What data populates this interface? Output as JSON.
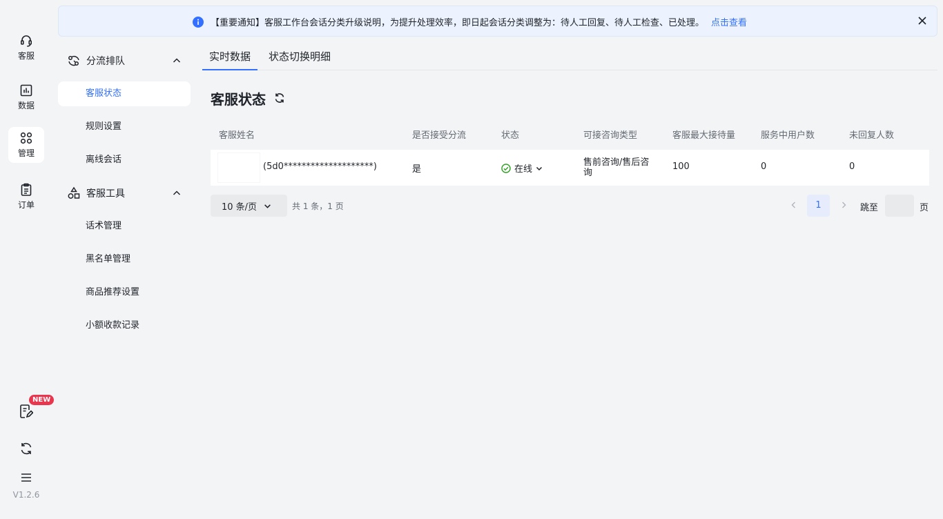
{
  "rail": {
    "items": [
      {
        "label": "客服",
        "icon": "headset-icon"
      },
      {
        "label": "数据",
        "icon": "bar-chart-icon"
      },
      {
        "label": "管理",
        "icon": "apps-icon"
      },
      {
        "label": "订单",
        "icon": "clipboard-icon"
      }
    ],
    "new_badge": "NEW",
    "version": "V1.2.6"
  },
  "notice": {
    "text": "【重要通知】客服工作台会话分类升级说明，为提升处理效率，即日起会话分类调整为：待人工回复、待人工检查、已处理。",
    "link": "点击查看"
  },
  "menu": {
    "group1": {
      "label": "分流排队",
      "items": [
        "客服状态",
        "规则设置",
        "离线会话"
      ]
    },
    "group2": {
      "label": "客服工具",
      "items": [
        "话术管理",
        "黑名单管理",
        "商品推荐设置",
        "小额收款记录"
      ]
    }
  },
  "tabs": [
    "实时数据",
    "状态切换明细"
  ],
  "page_title": "客服状态",
  "table": {
    "headers": [
      "客服姓名",
      "是否接受分流",
      "状态",
      "可接咨询类型",
      "客服最大接待量",
      "服务中用户数",
      "未回复人数"
    ],
    "rows": [
      {
        "name": "(5d0********************)",
        "accept": "是",
        "status": "在线",
        "types_line1": "售前咨询/售后咨",
        "types_line2": "询",
        "max": "100",
        "serving": "0",
        "unreplied": "0"
      }
    ]
  },
  "pagination": {
    "page_size": "10 条/页",
    "total": "共 1 条，1 页",
    "current": "1",
    "jump_label": "跳至",
    "page_label": "页",
    "jump_value": ""
  },
  "colors": {
    "accent": "#3370ff",
    "online": "#2ea121",
    "badge": "#e8364f"
  }
}
